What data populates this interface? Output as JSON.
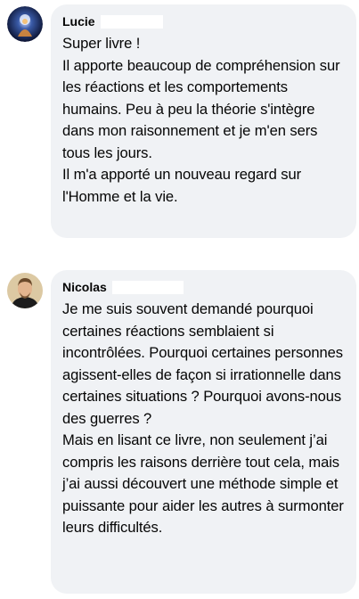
{
  "comments": [
    {
      "author": "Lucie",
      "avatar_icon": "cosmic-figure-avatar",
      "text": "Super livre !\nIl apporte beaucoup de compréhension sur les réactions et les comportements humains. Peu à peu la théorie s'intègre dans mon raisonnement et je m'en sers tous les jours.\nIl m'a apporté un nouveau regard sur l'Homme et la vie."
    },
    {
      "author": "Nicolas",
      "avatar_icon": "man-portrait-avatar",
      "text": "Je me suis souvent demandé pourquoi certaines réactions semblaient si incontrôlées. Pourquoi certaines personnes agissent-elles de façon si irrationnelle dans certaines situations ? Pourquoi avons-nous des guerres ?\nMais en lisant ce livre, non seulement j’ai compris les raisons derrière tout cela, mais j’ai aussi découvert une méthode simple et puissante pour aider les autres à surmonter leurs difficultés."
    }
  ],
  "colors": {
    "bubble_bg": "#f0f2f5",
    "text": "#050505"
  }
}
